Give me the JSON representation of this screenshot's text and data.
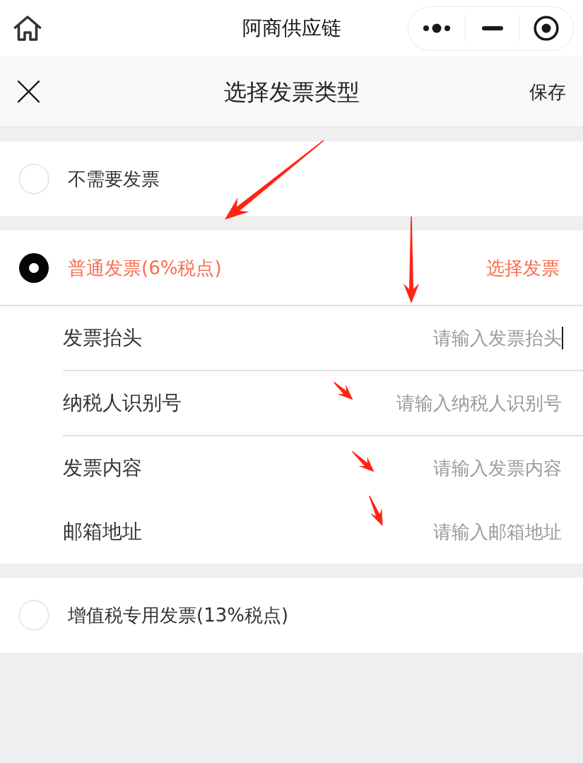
{
  "nav_bar": {
    "title": "阿商供应链"
  },
  "header": {
    "title": "选择发票类型",
    "save": "保存"
  },
  "options": [
    {
      "label": "不需要发票",
      "selected": false
    },
    {
      "label": "普通发票(6%税点)",
      "selected": true,
      "action": "选择发票",
      "fields": [
        {
          "label": "发票抬头",
          "placeholder": "请输入发票抬头",
          "focused": true,
          "underlined": true
        },
        {
          "label": "纳税人识别号",
          "placeholder": "请输入纳税人识别号",
          "focused": false,
          "underlined": true
        },
        {
          "label": "发票内容",
          "placeholder": "请输入发票内容",
          "focused": false,
          "underlined": false
        },
        {
          "label": "邮箱地址",
          "placeholder": "请输入邮箱地址",
          "focused": false,
          "underlined": false
        }
      ]
    },
    {
      "label": "增值税专用发票(13%税点)",
      "selected": false
    }
  ]
}
